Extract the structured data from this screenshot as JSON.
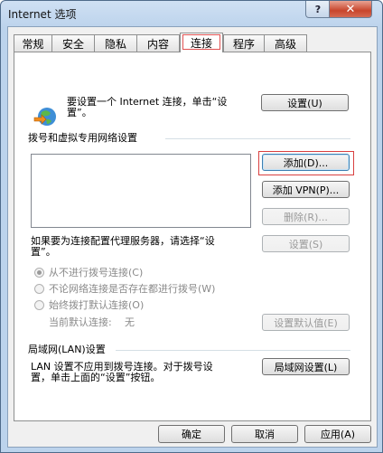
{
  "window": {
    "title": "Internet 选项",
    "help": "?",
    "close": "✕"
  },
  "tabs": [
    "常规",
    "安全",
    "隐私",
    "内容",
    "连接",
    "程序",
    "高级"
  ],
  "active_tab": "连接",
  "setup": {
    "text_line1": "要设置一个 Internet 连接，单击“设",
    "text_line2": "置”。",
    "button": "设置(U)"
  },
  "dialup": {
    "group_label": "拨号和虚拟专用网络设置",
    "add_button": "添加(D)...",
    "add_vpn_button": "添加 VPN(P)...",
    "delete_button": "删除(R)...",
    "proxy_text_line1": "如果要为连接配置代理服务器，请选择“设",
    "proxy_text_line2": "置”。",
    "settings_button": "设置(S)",
    "radio_never": "从不进行拨号连接(C)",
    "radio_no_network": "不论网络连接是否存在都进行拨号(W)",
    "radio_always": "始终拨打默认连接(O)",
    "current_default_label": "当前默认连接:",
    "current_default_value": "无",
    "set_default_button": "设置默认值(E)"
  },
  "lan": {
    "group_label": "局域网(LAN)设置",
    "text_line1": "LAN 设置不应用到拨号连接。对于拨号设",
    "text_line2": "置，单击上面的“设置”按钮。",
    "button": "局域网设置(L)"
  },
  "footer": {
    "ok": "确定",
    "cancel": "取消",
    "apply": "应用(A)"
  }
}
